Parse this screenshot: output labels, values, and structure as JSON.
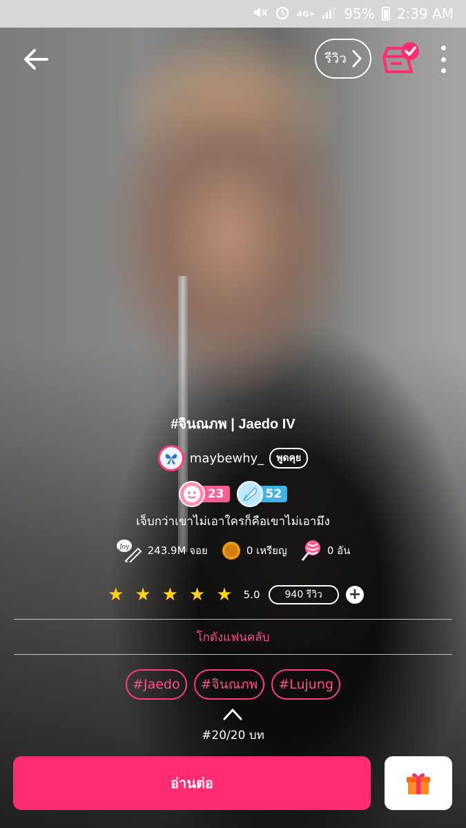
{
  "status_bar": {
    "battery": "95%",
    "time": "2:39 AM",
    "network": "4G+",
    "icons": [
      "mute-icon",
      "alarm-icon",
      "network-icon",
      "signal-icon",
      "battery-icon"
    ]
  },
  "topbar": {
    "review_label": "รีวิว",
    "icons": [
      "back-arrow-icon",
      "chevron-right-icon",
      "library-check-icon",
      "more-vertical-icon"
    ]
  },
  "novel": {
    "title": "#จินณภพ | Jaedo IV",
    "author": "maybewhy_",
    "chat_label": "พูดคุย",
    "badge_likes": "23",
    "badge_writes": "52",
    "tagline": "เจ็บกว่าเขาไม่เอาใครก็คือเขาไม่เอามึง",
    "stats": {
      "joy": "243.9M จอย",
      "coins": "0 เหรียญ",
      "candy": "0 อัน"
    },
    "rating": {
      "score": "5.0",
      "stars": 5,
      "review_count": "940 รีวิว"
    },
    "fanclub_label": "โกดังแฟนคลับ",
    "tags": [
      "#Jaedo",
      "#จินณภพ",
      "#Lujung"
    ],
    "episodes": "#20/20 บท"
  },
  "bottom": {
    "read_label": "อ่านต่อ",
    "joy_badge_text": "Joy"
  },
  "colors": {
    "accent_pink": "#ff2c73",
    "star_yellow": "#ffd21a",
    "badge_blue": "#3fb2e8"
  }
}
